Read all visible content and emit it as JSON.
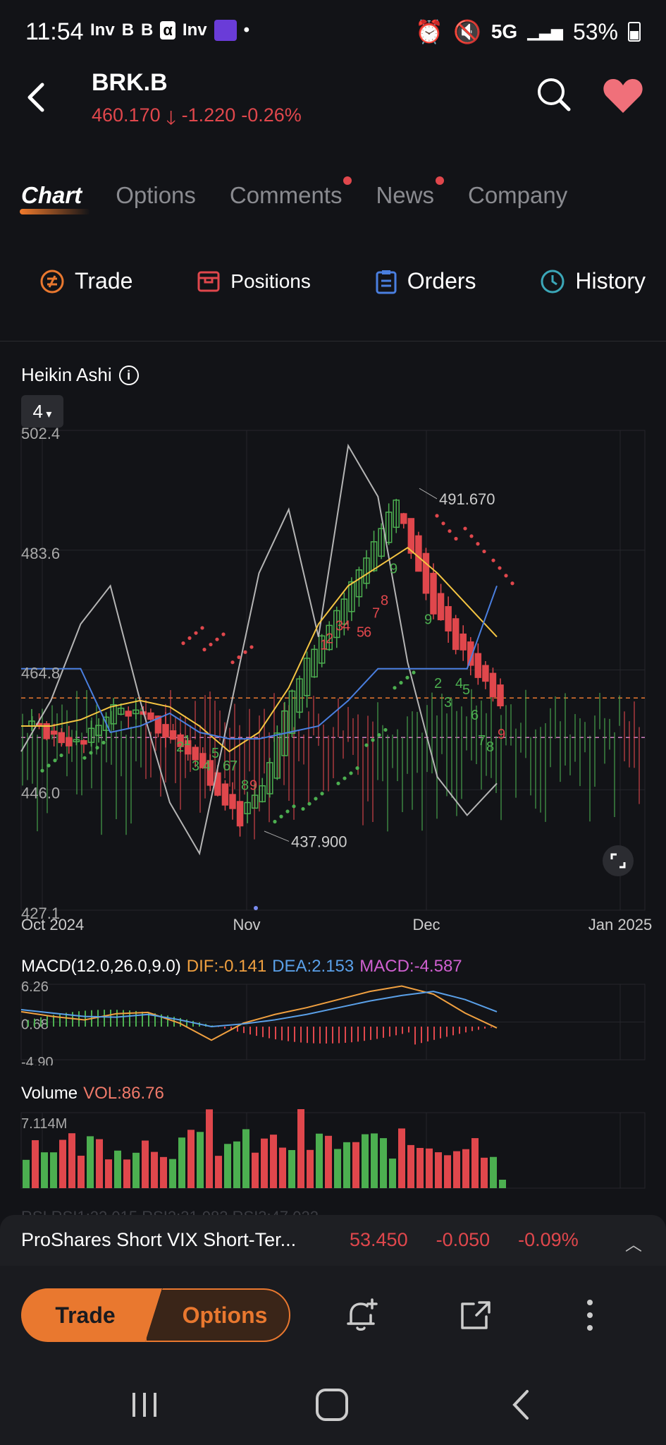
{
  "status_bar": {
    "time": "11:54",
    "notif_icons": [
      "Inv",
      "B",
      "B",
      "α",
      "Inv"
    ],
    "dot": "•",
    "network": "5G",
    "battery": "53%"
  },
  "header": {
    "ticker": "BRK.B",
    "price": "460.170",
    "change": "-1.220",
    "change_pct": "-0.26%"
  },
  "tabs": [
    {
      "label": "Chart",
      "active": true,
      "dot": false
    },
    {
      "label": "Options",
      "active": false,
      "dot": false
    },
    {
      "label": "Comments",
      "active": false,
      "dot": true
    },
    {
      "label": "News",
      "active": false,
      "dot": true
    },
    {
      "label": "Company",
      "active": false,
      "dot": false
    }
  ],
  "actions": {
    "trade": "Trade",
    "positions": "Positions",
    "orders": "Orders",
    "history": "History"
  },
  "chart": {
    "title": "Heikin Ashi",
    "info": "i",
    "period": "4",
    "y_ticks": [
      "502.4",
      "483.6",
      "464.8",
      "446.0",
      "427.1"
    ],
    "x_ticks": [
      "Oct 2024",
      "Nov",
      "Dec",
      "Jan 2025"
    ],
    "high_label": "491.670",
    "low_label": "437.900",
    "td_labels": [
      "1",
      "2",
      "3",
      "4",
      "5",
      "6",
      "7",
      "8",
      "9",
      "1",
      "2",
      "3",
      "4",
      "5",
      "6",
      "7",
      "8",
      "9",
      "2",
      "3",
      "4",
      "5",
      "6",
      "7",
      "8",
      "9",
      "9"
    ]
  },
  "chart_data": {
    "type": "line",
    "title": "",
    "xlabel": "",
    "ylabel": "",
    "ylim": [
      427.1,
      502.4
    ],
    "categories": [
      "Oct 2024",
      "Nov",
      "Dec",
      "Jan 2025"
    ],
    "series": [
      {
        "name": "",
        "values": [
          456,
          454,
          453,
          459,
          458,
          455,
          452,
          447,
          441,
          448,
          462,
          470,
          476,
          484,
          491,
          478,
          470,
          465,
          460
        ]
      }
    ],
    "annotations": [
      "491.670",
      "437.900"
    ]
  },
  "macd": {
    "title": "MACD(12.0,26.0,9.0)",
    "dif": "DIF:-0.141",
    "dea": "DEA:2.153",
    "macd": "MACD:-4.587",
    "y_ticks": [
      "6.26",
      "0.68",
      "-4.90"
    ]
  },
  "volume": {
    "title": "Volume",
    "vol": "VOL:86.76",
    "y_tick": "7.114M"
  },
  "rsi_ghost": "RSI RSI1:22.015 RSI2:31.983 RSI3:47.022",
  "ticker_bar": {
    "name": "ProShares Short VIX Short-Ter...",
    "price": "53.450",
    "change": "-0.050",
    "change_pct": "-0.09%"
  },
  "bottom": {
    "trade": "Trade",
    "options": "Options"
  },
  "colors": {
    "up": "#4caf50",
    "down": "#e0474c",
    "accent": "#e9782f",
    "bg": "#121317"
  }
}
